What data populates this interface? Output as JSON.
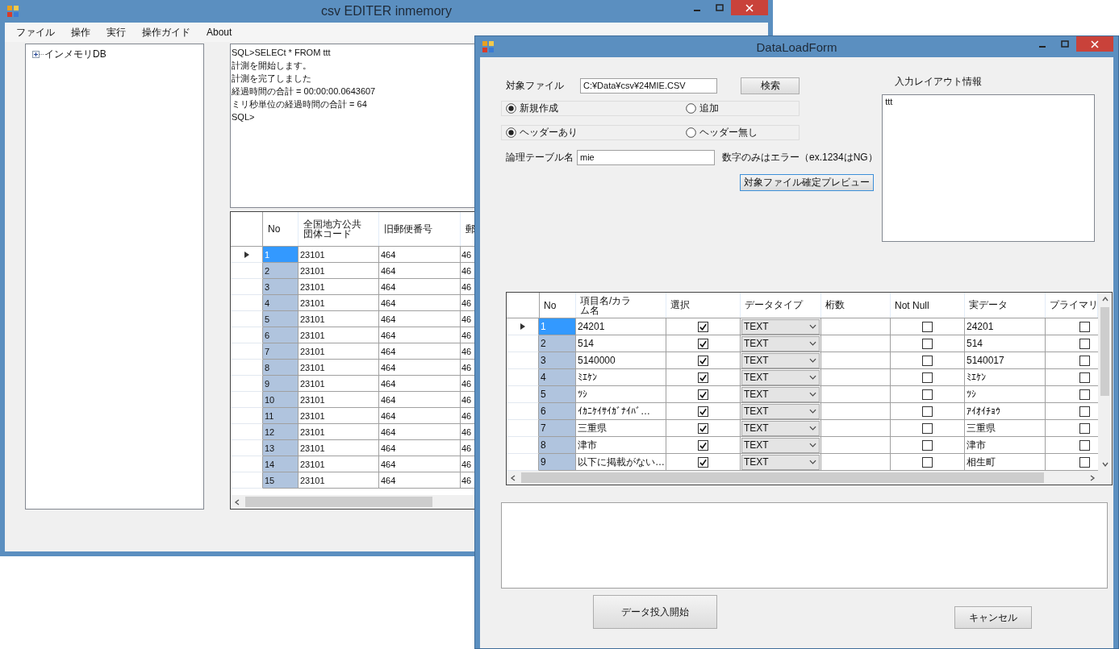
{
  "main_window": {
    "title": "csv EDITER inmemory",
    "menu": [
      "ファイル",
      "操作",
      "実行",
      "操作ガイド",
      "About"
    ],
    "tree": [
      {
        "label": "インメモリDB",
        "expanded": false
      }
    ],
    "console": [
      "SQL>SELECt * FROM ttt",
      "計測を開始します。",
      "計測を完了しました",
      "経過時間の合計 = 00:00:00.0643607",
      "ミリ秒単位の経過時間の合計 = 64",
      "SQL>"
    ],
    "grid": {
      "columns": [
        "No",
        "全国地方公共団体コード",
        "旧郵便番号",
        "郵"
      ],
      "rows": [
        {
          "cells": [
            "1",
            "23101",
            "464",
            "46"
          ],
          "selected": true
        },
        {
          "cells": [
            "2",
            "23101",
            "464",
            "46"
          ],
          "selected": false
        },
        {
          "cells": [
            "3",
            "23101",
            "464",
            "46"
          ],
          "selected": false
        },
        {
          "cells": [
            "4",
            "23101",
            "464",
            "46"
          ],
          "selected": false
        },
        {
          "cells": [
            "5",
            "23101",
            "464",
            "46"
          ],
          "selected": false
        },
        {
          "cells": [
            "6",
            "23101",
            "464",
            "46"
          ],
          "selected": false
        },
        {
          "cells": [
            "7",
            "23101",
            "464",
            "46"
          ],
          "selected": false
        },
        {
          "cells": [
            "8",
            "23101",
            "464",
            "46"
          ],
          "selected": false
        },
        {
          "cells": [
            "9",
            "23101",
            "464",
            "46"
          ],
          "selected": false
        },
        {
          "cells": [
            "10",
            "23101",
            "464",
            "46"
          ],
          "selected": false
        },
        {
          "cells": [
            "11",
            "23101",
            "464",
            "46"
          ],
          "selected": false
        },
        {
          "cells": [
            "12",
            "23101",
            "464",
            "46"
          ],
          "selected": false
        },
        {
          "cells": [
            "13",
            "23101",
            "464",
            "46"
          ],
          "selected": false
        },
        {
          "cells": [
            "14",
            "23101",
            "464",
            "46"
          ],
          "selected": false
        },
        {
          "cells": [
            "15",
            "23101",
            "464",
            "46"
          ],
          "selected": false
        }
      ]
    }
  },
  "dialog": {
    "title": "DataLoadForm",
    "file_label": "対象ファイル",
    "file_path": "C:¥Data¥csv¥24MIE.CSV",
    "search_button": "検索",
    "radio_groups": [
      [
        {
          "label": "新規作成",
          "selected": true
        },
        {
          "label": "追加",
          "selected": false
        }
      ],
      [
        {
          "label": "ヘッダーあり",
          "selected": true
        },
        {
          "label": "ヘッダー無し",
          "selected": false
        }
      ]
    ],
    "table_name_label": "論理テーブル名",
    "table_name": "mie",
    "table_name_note": "数字のみはエラー（ex.1234はNG）",
    "preview_button": "対象ファイル確定プレビュー",
    "layout_label": "入力レイアウト情報",
    "layout_text": "ttt",
    "grid": {
      "columns": [
        "No",
        "項目名/カラム名",
        "選択",
        "データタイプ",
        "桁数",
        "Not  Null",
        "実データ",
        "プライマリ"
      ],
      "rows": [
        {
          "no": "1",
          "name": "24201",
          "checked": true,
          "type": "TEXT",
          "not_null": false,
          "actual": "24201",
          "primary": false,
          "selected": true
        },
        {
          "no": "2",
          "name": "514",
          "checked": true,
          "type": "TEXT",
          "not_null": false,
          "actual": "514",
          "primary": false,
          "selected": false
        },
        {
          "no": "3",
          "name": "5140000",
          "checked": true,
          "type": "TEXT",
          "not_null": false,
          "actual": "5140017",
          "primary": false,
          "selected": false
        },
        {
          "no": "4",
          "name": "ﾐｴｹﾝ",
          "checked": true,
          "type": "TEXT",
          "not_null": false,
          "actual": "ﾐｴｹﾝ",
          "primary": false,
          "selected": false
        },
        {
          "no": "5",
          "name": "ﾂｼ",
          "checked": true,
          "type": "TEXT",
          "not_null": false,
          "actual": "ﾂｼ",
          "primary": false,
          "selected": false
        },
        {
          "no": "6",
          "name": "ｲｶﾆｹｲｻｲｶﾞﾅｲﾊﾞ…",
          "checked": true,
          "type": "TEXT",
          "not_null": false,
          "actual": "ｱｲｵｲﾁｮｳ",
          "primary": false,
          "selected": false
        },
        {
          "no": "7",
          "name": "三重県",
          "checked": true,
          "type": "TEXT",
          "not_null": false,
          "actual": "三重県",
          "primary": false,
          "selected": false
        },
        {
          "no": "8",
          "name": "津市",
          "checked": true,
          "type": "TEXT",
          "not_null": false,
          "actual": "津市",
          "primary": false,
          "selected": false
        },
        {
          "no": "9",
          "name": "以下に掲載がない…",
          "checked": true,
          "type": "TEXT",
          "not_null": false,
          "actual": "相生町",
          "primary": false,
          "selected": false
        }
      ]
    },
    "start_button": "データ投入開始",
    "cancel_button": "キャンセル"
  }
}
